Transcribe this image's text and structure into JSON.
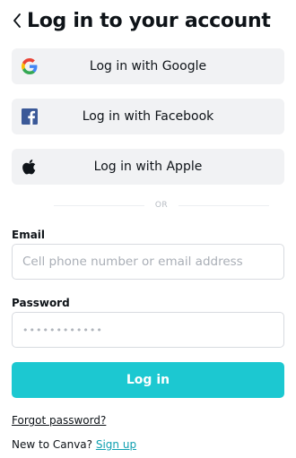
{
  "header": {
    "title": "Log in to your account",
    "back_icon": "chevron-left-icon"
  },
  "social": {
    "google": {
      "label": "Log in with Google",
      "icon": "google-icon"
    },
    "facebook": {
      "label": "Log in with Facebook",
      "icon": "facebook-icon",
      "color": "#3b5998"
    },
    "apple": {
      "label": "Log in with Apple",
      "icon": "apple-icon"
    }
  },
  "divider": {
    "text": "OR"
  },
  "form": {
    "email": {
      "label": "Email",
      "placeholder": "Cell phone number or email address",
      "value": ""
    },
    "password": {
      "label": "Password",
      "placeholder": "••••••••••••",
      "value": ""
    },
    "submit_label": "Log in"
  },
  "footer": {
    "forgot_password": "Forgot password?",
    "new_prompt": "New to Canva?",
    "signup_label": "Sign up"
  },
  "colors": {
    "accent": "#1cc8d1",
    "link": "#0e9fb0",
    "button_bg": "#f1f2f4"
  }
}
